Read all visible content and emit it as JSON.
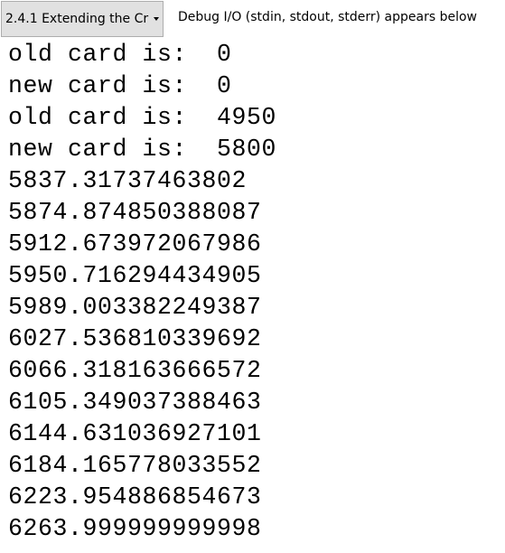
{
  "toolbar": {
    "program_selector": "2.4.1 Extending the Cr",
    "debug_label": "Debug I/O (stdin, stdout, stderr) appears below"
  },
  "output": {
    "lines": [
      "old card is:  0",
      "new card is:  0",
      "old card is:  4950",
      "new card is:  5800",
      "5837.31737463802",
      "5874.874850388087",
      "5912.673972067986",
      "5950.716294434905",
      "5989.003382249387",
      "6027.536810339692",
      "6066.318163666572",
      "6105.349037388463",
      "6144.631036927101",
      "6184.165778033552",
      "6223.954886854673",
      "6263.999999999998"
    ]
  }
}
